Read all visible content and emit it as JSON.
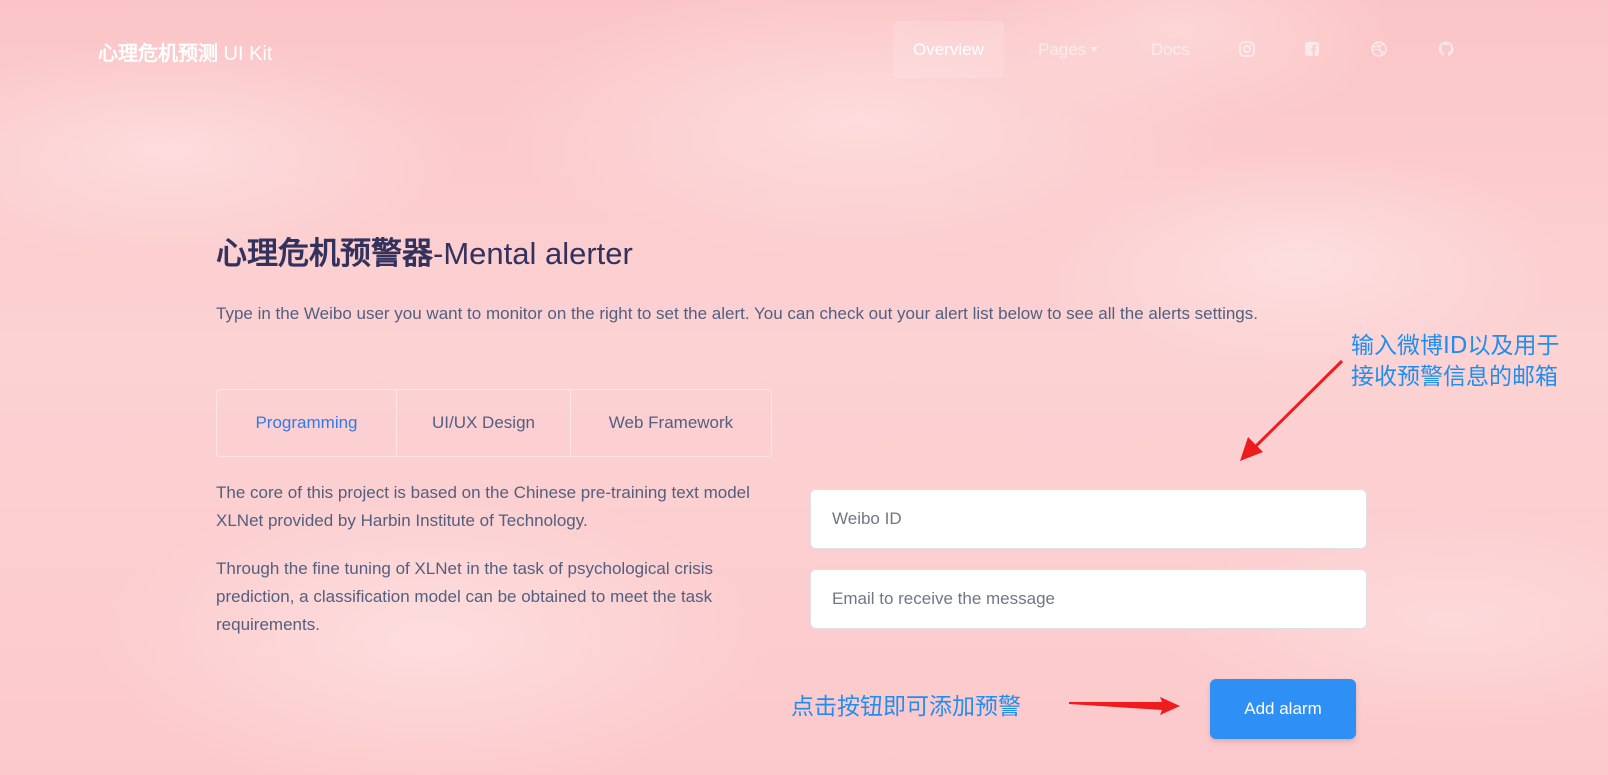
{
  "navbar": {
    "brand_bold": "心理危机预测",
    "brand_light": " UI Kit",
    "items": [
      {
        "label": "Overview",
        "active": true
      },
      {
        "label": "Pages",
        "has_dropdown": true
      },
      {
        "label": "Docs"
      }
    ],
    "icons": [
      "instagram-icon",
      "facebook-icon",
      "dribbble-icon",
      "github-icon"
    ]
  },
  "hero": {
    "title_cn": "心理危机预警器",
    "title_en": "-Mental alerter",
    "lead": "Type in the Weibo user you want to monitor on the right to set the alert. You can check out your alert list below to see all the alerts settings."
  },
  "tabs": [
    {
      "label": "Programming",
      "active": true
    },
    {
      "label": "UI/UX Design"
    },
    {
      "label": "Web Framework"
    }
  ],
  "content": {
    "paragraph_1": "The core of this project is based on the Chinese pre-training text model XLNet provided by Harbin Institute of Technology.",
    "paragraph_2": "Through the fine tuning of XLNet in the task of psychological crisis prediction, a classification model can be obtained to meet the task requirements."
  },
  "form": {
    "weibo_id_placeholder": "Weibo ID",
    "email_placeholder": "Email to receive the message",
    "submit_label": "Add alarm"
  },
  "annotations": {
    "form_note_line1": "输入微博ID以及用于",
    "form_note_line2": "接收预警信息的邮箱",
    "button_note": "点击按钮即可添加预警"
  },
  "colors": {
    "primary": "#2e8ff5",
    "tab_active": "#2f7bea",
    "annotation_text": "#1f8ef0",
    "annotation_arrow": "#ee1c1c"
  }
}
